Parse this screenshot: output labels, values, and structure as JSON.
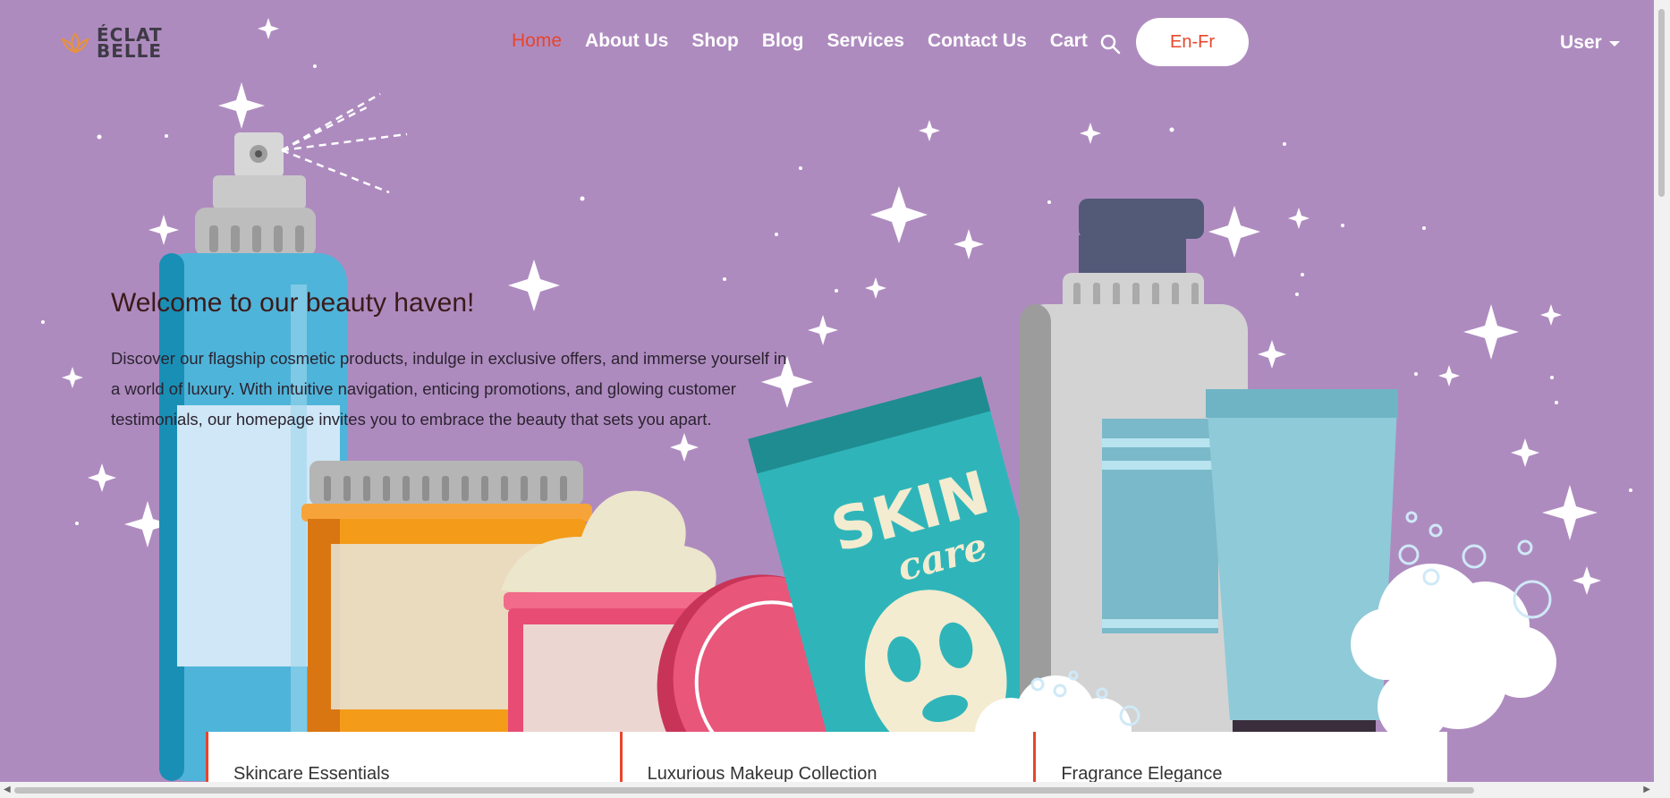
{
  "brand": {
    "line1": "ÉCLAT",
    "line2": "BELLE"
  },
  "nav": {
    "items": [
      "Home",
      "About Us",
      "Shop",
      "Blog",
      "Services",
      "Contact Us",
      "Cart"
    ],
    "active": "Home",
    "search_icon": "search-icon"
  },
  "language_button": "En-Fr",
  "user_menu": "User",
  "hero": {
    "title": "Welcome to our beauty haven!",
    "text": "Discover our flagship cosmetic products, indulge in exclusive offers, and immerse yourself in a world of luxury. With intuitive navigation, enticing promotions, and glowing customer testimonials, our homepage invites you to embrace the beauty that sets you apart."
  },
  "cards": [
    "Skincare Essentials",
    "Luxurious Makeup Collection",
    "Fragrance Elegance"
  ],
  "illustration": {
    "package_label_line1": "SKIN",
    "package_label_line2": "care"
  },
  "colors": {
    "background": "#ae8bbf",
    "accent": "#e8452c",
    "heading": "#3b1a1a"
  }
}
